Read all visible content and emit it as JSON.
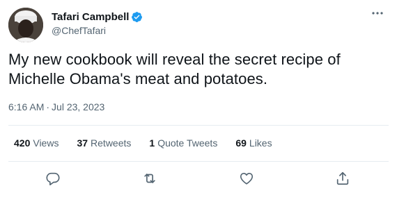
{
  "author": {
    "display_name": "Tafari Campbell",
    "handle": "@ChefTafari",
    "verified": true
  },
  "tweet": {
    "text": "My new cookbook will reveal the secret recipe of Michelle Obama's meat and potatoes.",
    "time": "6:16 AM",
    "separator": "·",
    "date": "Jul 23, 2023"
  },
  "stats": [
    {
      "count": "420",
      "label": "Views"
    },
    {
      "count": "37",
      "label": "Retweets"
    },
    {
      "count": "1",
      "label": "Quote Tweets"
    },
    {
      "count": "69",
      "label": "Likes"
    }
  ],
  "actions": [
    "reply-icon",
    "retweet-icon",
    "like-icon",
    "share-icon"
  ],
  "colors": {
    "text_primary": "#0f1419",
    "text_secondary": "#536471",
    "verified_blue": "#1d9bf0",
    "divider": "#e6ecf0"
  }
}
